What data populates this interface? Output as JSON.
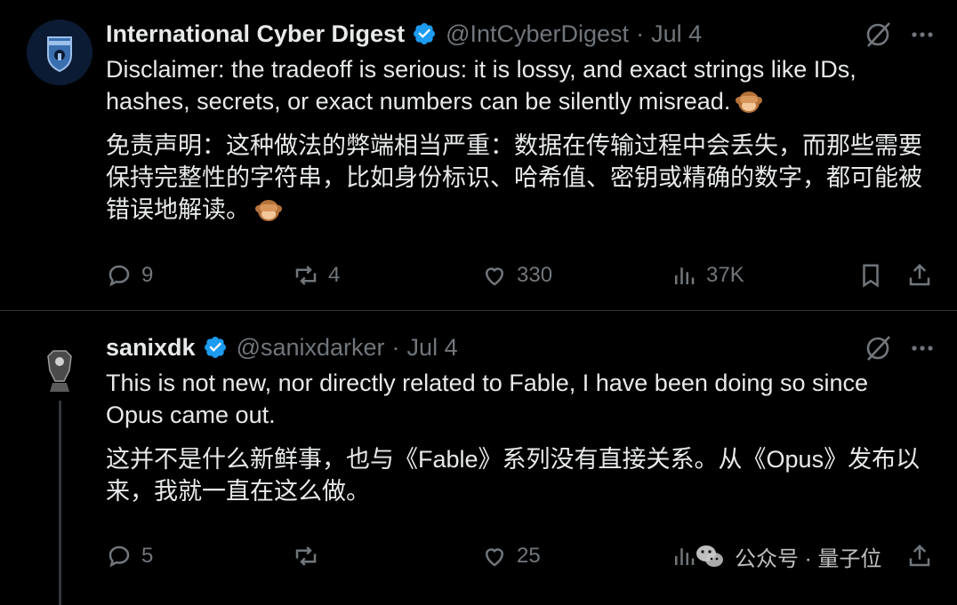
{
  "tweets": [
    {
      "display_name": "International Cyber Digest",
      "handle": "@IntCyberDigest",
      "separator": "·",
      "date": "Jul 4",
      "text_en": "Disclaimer: the tradeoff is serious: it is lossy, and exact strings like IDs, hashes, secrets, or exact numbers can be silently misread.",
      "text_zh": "免责声明：这种做法的弊端相当严重：数据在传输过程中会丢失，而那些需要保持完整性的字符串，比如身份标识、哈希值、密钥或精确的数字，都可能被错误地解读。",
      "emoji": "see-no-evil-monkey",
      "stats": {
        "replies": "9",
        "reposts": "4",
        "likes": "330",
        "views": "37K"
      }
    },
    {
      "display_name": "sanixdk",
      "handle": "@sanixdarker",
      "separator": "·",
      "date": "Jul 4",
      "text_en": "This is not new, nor directly related to Fable, I have been doing so since Opus came out.",
      "text_zh": "这并不是什么新鲜事，也与《Fable》系列没有直接关系。从《Opus》发布以来，我就一直在这么做。",
      "stats": {
        "replies": "5",
        "reposts": "",
        "likes": "25",
        "views": ""
      }
    }
  ],
  "watermark": {
    "text": "公众号 · 量子位"
  },
  "colors": {
    "background": "#000000",
    "text": "#e7e9ea",
    "muted": "#71767b",
    "verified": "#1d9bf0",
    "divider": "#2f3336"
  },
  "icons": [
    "verified-badge-icon",
    "grok-icon",
    "more-icon",
    "reply-icon",
    "repost-icon",
    "like-icon",
    "views-icon",
    "bookmark-icon",
    "share-icon",
    "wechat-icon"
  ]
}
